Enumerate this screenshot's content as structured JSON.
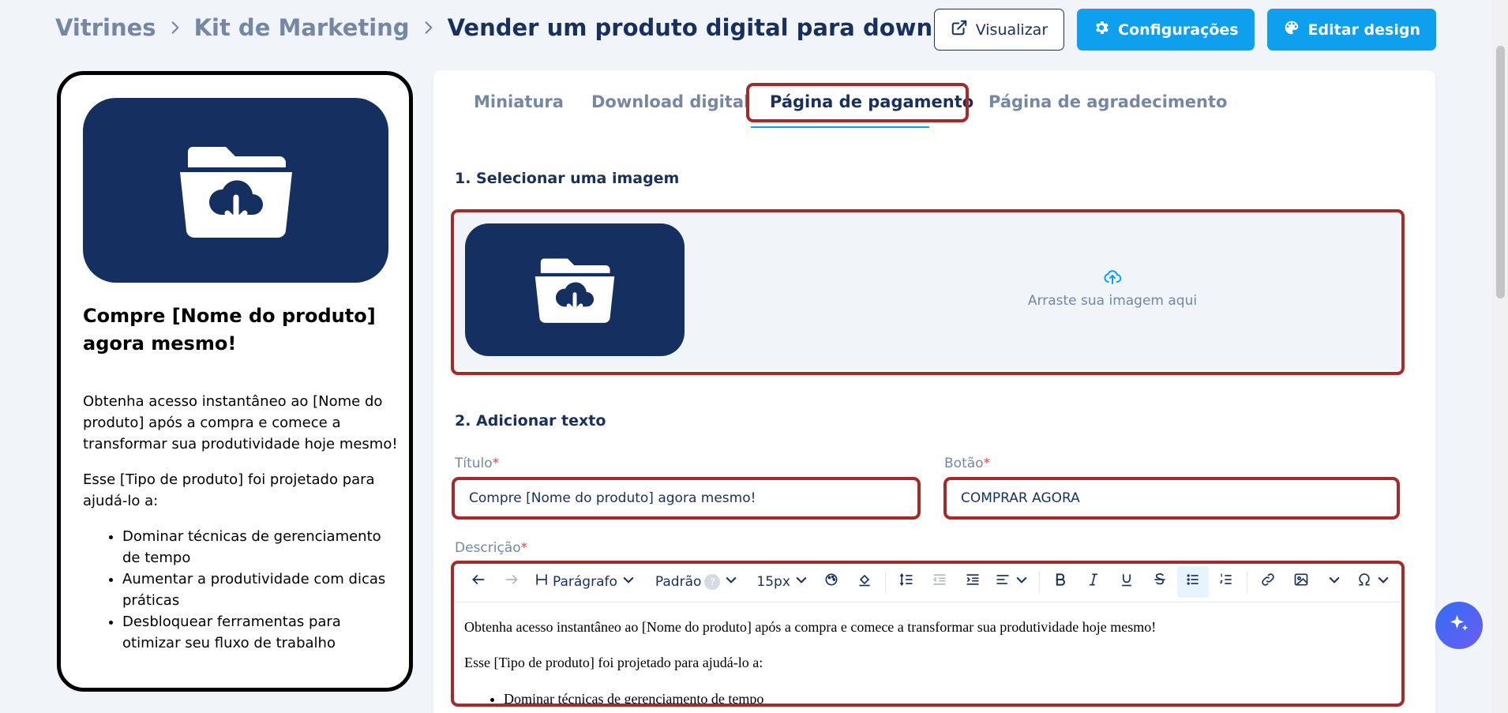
{
  "breadcrumb": {
    "items": [
      "Vitrines",
      "Kit de Marketing"
    ],
    "current": "Vender um produto digital para download"
  },
  "top_actions": {
    "preview_label": "Visualizar",
    "settings_label": "Configurações",
    "edit_design_label": "Editar design"
  },
  "preview": {
    "title": "Compre [Nome do produto] agora mesmo!",
    "paragraph1": "Obtenha acesso instantâneo ao [Nome do produto] após a compra e comece a transformar sua produtividade hoje mesmo!",
    "paragraph2": "Esse [Tipo de produto] foi projetado para ajudá-lo a:",
    "bullets": [
      "Dominar técnicas de gerenciamento de tempo",
      "Aumentar a produtividade com dicas práticas",
      "Desbloquear ferramentas para otimizar seu fluxo de trabalho"
    ]
  },
  "tabs": [
    {
      "label": "Miniatura"
    },
    {
      "label": "Download digital"
    },
    {
      "label": "Página de pagamento"
    },
    {
      "label": "Página de agradecimento"
    }
  ],
  "active_tab": "Página de pagamento",
  "section1": {
    "title": "1. Selecionar uma imagem",
    "drop_text": "Arraste sua imagem aqui"
  },
  "section2": {
    "title": "2. Adicionar texto",
    "title_label": "Título",
    "title_value": "Compre [Nome do produto] agora mesmo!",
    "button_label": "Botão",
    "button_value": "COMPRAR AGORA",
    "description_label": "Descrição",
    "required_mark": "*"
  },
  "editor": {
    "toolbar": {
      "paragraph_label": "Parágrafo",
      "font_label": "Padrão",
      "font_help": "?",
      "size_label": "15px"
    },
    "paragraph1": "Obtenha acesso instantâneo ao [Nome do produto] após a compra e comece a transformar sua produtividade hoje mesmo!",
    "paragraph2": "Esse [Tipo de produto] foi projetado para ajudá-lo a:",
    "bullets": [
      "Dominar técnicas de gerenciamento de tempo"
    ]
  },
  "colors": {
    "navy": "#17305e",
    "accent_blue": "#0ea0ee",
    "highlight_red": "#a52a2a",
    "muted": "#7487a3"
  },
  "icons": {
    "crumb_separator": "chevron-right-icon",
    "preview_button": "external-link-icon",
    "settings_button": "gear-icon",
    "edit_design_button": "palette-icon",
    "hero": "folder-download-icon",
    "dropzone": "cloud-upload-icon",
    "fab": "sparkle-icon"
  }
}
